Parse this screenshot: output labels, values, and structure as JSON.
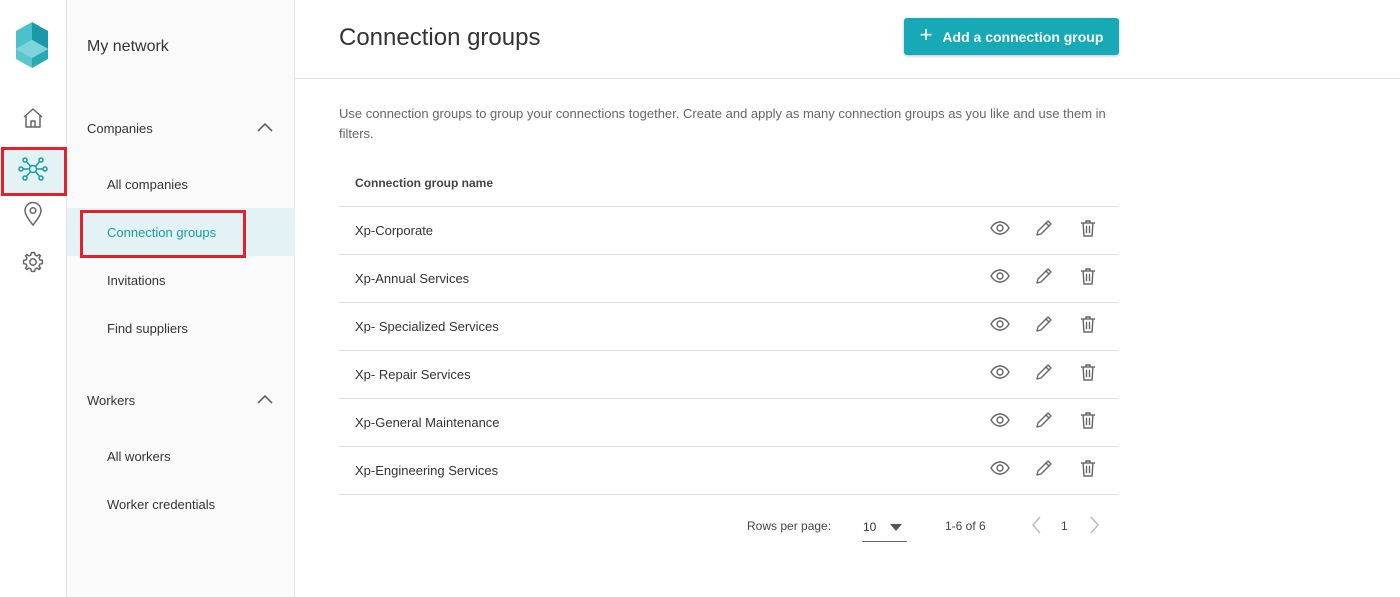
{
  "nav": {
    "home_icon": "home-icon",
    "network_icon": "network-icon",
    "location_icon": "location-pin-icon",
    "settings_icon": "gear-icon"
  },
  "sidebar": {
    "title": "My network",
    "sections": [
      {
        "label": "Companies",
        "items": [
          "All companies",
          "Connection groups",
          "Invitations",
          "Find suppliers"
        ]
      },
      {
        "label": "Workers",
        "items": [
          "All workers",
          "Worker credentials"
        ]
      }
    ]
  },
  "header": {
    "title": "Connection groups",
    "add_button": "Add a connection group"
  },
  "description": "Use connection groups to group your connections together. Create and apply as many connection groups as you like and use them in filters.",
  "table": {
    "column": "Connection group name",
    "rows": [
      "Xp-Corporate",
      "Xp-Annual Services",
      "Xp- Specialized Services",
      "Xp- Repair Services",
      "Xp-General Maintenance",
      "Xp-Engineering Services"
    ]
  },
  "pagination": {
    "rows_label": "Rows per page:",
    "rows_value": "10",
    "range": "1-6 of 6",
    "page": "1"
  },
  "colors": {
    "accent": "#17a9b6",
    "active_bg": "#e3f3f5",
    "highlight": "#e0222e"
  }
}
